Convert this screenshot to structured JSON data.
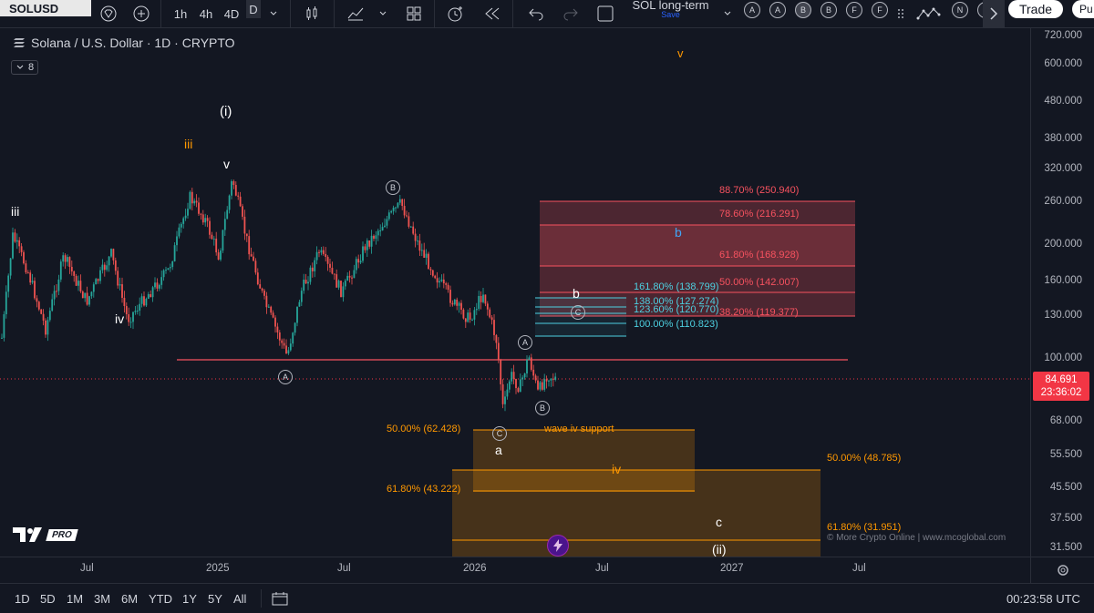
{
  "toolbar": {
    "symbol": "SOLUSD",
    "intervals": [
      "1h",
      "4h",
      "4D",
      "D"
    ],
    "layout_name": "SOL long-term",
    "layout_status": "Save",
    "letter_buttons": [
      "A",
      "A",
      "B",
      "B",
      "F",
      "F"
    ],
    "right_buttons": [
      "N",
      "S"
    ],
    "trade_label": "Trade",
    "publish_label": "Pu"
  },
  "legend": {
    "title": "Solana / U.S. Dollar · 1D · CRYPTO",
    "indicator_count": "8"
  },
  "price_axis": [
    "720.000",
    "600.000",
    "480.000",
    "380.000",
    "320.000",
    "260.000",
    "200.000",
    "160.000",
    "130.000",
    "100.000",
    "68.000",
    "55.500",
    "45.500",
    "37.500",
    "31.500"
  ],
  "current_price": {
    "value": "84.691",
    "countdown": "23:36:02"
  },
  "time_axis": [
    "Jul",
    "2025",
    "Jul",
    "2026",
    "Jul",
    "2027",
    "Jul"
  ],
  "ranges": [
    "1D",
    "5D",
    "1M",
    "3M",
    "6M",
    "YTD",
    "1Y",
    "5Y",
    "All"
  ],
  "clock": "00:23:58 UTC",
  "watermark": "© More Crypto Online  |  www.mcoglobal.com",
  "logo_badge": "PRO",
  "waves": {
    "w_iii_left": "iii",
    "w_iii_orange": "iii",
    "w_i": "(i)",
    "w_v": "v",
    "w_iv": "iv",
    "w_v_top": "v",
    "w_b_blue": "b",
    "w_b_white": "b",
    "w_a": "a",
    "w_iv_orange": "iv",
    "w_c": "c",
    "w_ii": "(ii)",
    "circ_A1": "A",
    "circ_B1": "B",
    "circ_C1": "C",
    "circ_A2": "A",
    "circ_B2": "B",
    "circ_C2": "C",
    "wave_iv_support": "wave iv support"
  },
  "fib_red": [
    "88.70% (250.940)",
    "78.60% (216.291)",
    "61.80% (168.928)",
    "50.00% (142.007)",
    "38.20% (119.377)"
  ],
  "fib_blue": [
    "161.80% (138.799)",
    "138.00% (127.274)",
    "123.60% (120.770)",
    "100.00% (110.823)"
  ],
  "fib_orange": [
    "50.00% (62.428)",
    "61.80% (43.222)",
    "50.00% (48.785)",
    "61.80% (31.951)"
  ],
  "colors": {
    "background": "#131722",
    "up": "#26a69a",
    "down": "#ef5350",
    "fib_red": "#f7525f",
    "fib_blue": "#4dd0e1",
    "fib_orange": "#ff9800",
    "price_tag": "#f23645"
  }
}
